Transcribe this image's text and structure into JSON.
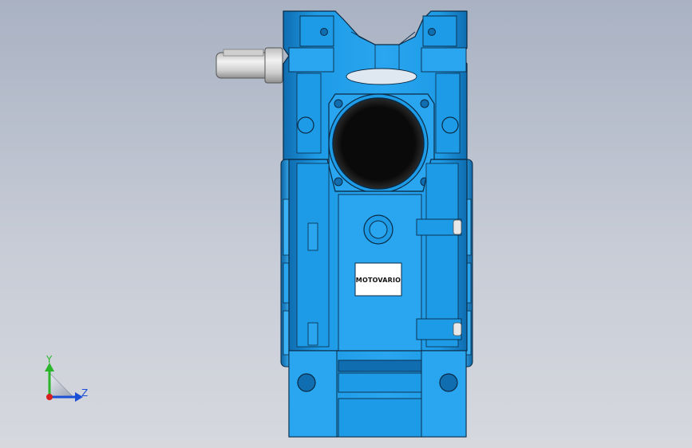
{
  "viewport": {
    "background_top": "#a9b2c3",
    "background_bottom": "#d6d8de"
  },
  "model": {
    "body_color": "#1e9be6",
    "body_highlight": "#5cc0ff",
    "body_shadow": "#0f6db0",
    "edge_color": "#0a2a44",
    "shaft_color": "#d8d8d8",
    "bore_color": "#111111",
    "nameplate": {
      "text": "MOTOVARIO"
    }
  },
  "triad": {
    "y_label": "Y",
    "z_label": "Z",
    "y_color": "#2bb52b",
    "z_color": "#1a4fd6",
    "x_color": "#d81f1f"
  }
}
